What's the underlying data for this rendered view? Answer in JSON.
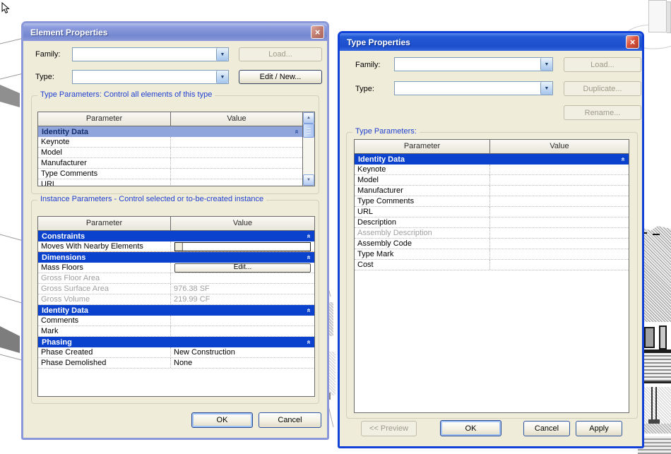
{
  "icons": {
    "close": "×",
    "combo_arrow": "▼",
    "scroll_up": "▲",
    "scroll_down": "▼",
    "collapse_chevron": "«",
    "compass_south": "S"
  },
  "colors": {
    "dialog_face": "#efecda",
    "active_titlebar": "#1c4ecb",
    "inactive_titlebar": "#8494d6",
    "section_header_blue": "#0a42cd",
    "section_header_soft": "#8fa5dc",
    "groupbox_label_blue": "#1f3fd0",
    "disabled_text": "#9e9b8a",
    "close_button_red": "#d4543e"
  },
  "element_properties_dialog": {
    "title": "Element Properties",
    "family_label": "Family:",
    "type_label": "Type:",
    "family_value": "",
    "type_value": "",
    "load_button": "Load...",
    "edit_new_button": "Edit / New...",
    "type_parameters_group": "Type Parameters: Control all elements of this type",
    "type_table": {
      "headers": {
        "parameter": "Parameter",
        "value": "Value"
      },
      "rows": [
        {
          "kind": "section",
          "label": "Identity Data",
          "variant": "soft"
        },
        {
          "kind": "item",
          "label": "Keynote",
          "value": ""
        },
        {
          "kind": "item",
          "label": "Model",
          "value": ""
        },
        {
          "kind": "item",
          "label": "Manufacturer",
          "value": ""
        },
        {
          "kind": "item",
          "label": "Type Comments",
          "value": ""
        },
        {
          "kind": "item",
          "label": "URL",
          "value": ""
        }
      ]
    },
    "instance_parameters_group": "Instance Parameters - Control selected or to-be-created instance",
    "instance_table": {
      "headers": {
        "parameter": "Parameter",
        "value": "Value"
      },
      "rows": [
        {
          "kind": "section",
          "label": "Constraints"
        },
        {
          "kind": "item",
          "label": "Moves With Nearby Elements",
          "control": "checkbox-field",
          "focus": true
        },
        {
          "kind": "section",
          "label": "Dimensions"
        },
        {
          "kind": "item",
          "label": "Mass Floors",
          "control": "edit-button",
          "button_label": "Edit..."
        },
        {
          "kind": "item",
          "label": "Gross Floor Area",
          "value": "",
          "disabled": true
        },
        {
          "kind": "item",
          "label": "Gross Surface Area",
          "value": "976.38 SF",
          "disabled": true
        },
        {
          "kind": "item",
          "label": "Gross Volume",
          "value": "219.99 CF",
          "disabled": true
        },
        {
          "kind": "section",
          "label": "Identity Data"
        },
        {
          "kind": "item",
          "label": "Comments",
          "value": ""
        },
        {
          "kind": "item",
          "label": "Mark",
          "value": ""
        },
        {
          "kind": "section",
          "label": "Phasing"
        },
        {
          "kind": "item",
          "label": "Phase Created",
          "value": "New Construction"
        },
        {
          "kind": "item",
          "label": "Phase Demolished",
          "value": "None"
        }
      ]
    },
    "ok_button": "OK",
    "cancel_button": "Cancel"
  },
  "type_properties_dialog": {
    "title": "Type Properties",
    "family_label": "Family:",
    "type_label": "Type:",
    "family_value": "",
    "type_value": "",
    "load_button": "Load...",
    "duplicate_button": "Duplicate...",
    "rename_button": "Rename...",
    "type_parameters_group": "Type Parameters:",
    "type_table": {
      "headers": {
        "parameter": "Parameter",
        "value": "Value"
      },
      "rows": [
        {
          "kind": "section",
          "label": "Identity Data"
        },
        {
          "kind": "item",
          "label": "Keynote",
          "value": ""
        },
        {
          "kind": "item",
          "label": "Model",
          "value": ""
        },
        {
          "kind": "item",
          "label": "Manufacturer",
          "value": ""
        },
        {
          "kind": "item",
          "label": "Type Comments",
          "value": ""
        },
        {
          "kind": "item",
          "label": "URL",
          "value": ""
        },
        {
          "kind": "item",
          "label": "Description",
          "value": ""
        },
        {
          "kind": "item",
          "label": "Assembly Description",
          "value": "",
          "disabled": true
        },
        {
          "kind": "item",
          "label": "Assembly Code",
          "value": ""
        },
        {
          "kind": "item",
          "label": "Type Mark",
          "value": ""
        },
        {
          "kind": "item",
          "label": "Cost",
          "value": ""
        }
      ]
    },
    "preview_button": "<< Preview",
    "ok_button": "OK",
    "cancel_button": "Cancel",
    "apply_button": "Apply"
  }
}
